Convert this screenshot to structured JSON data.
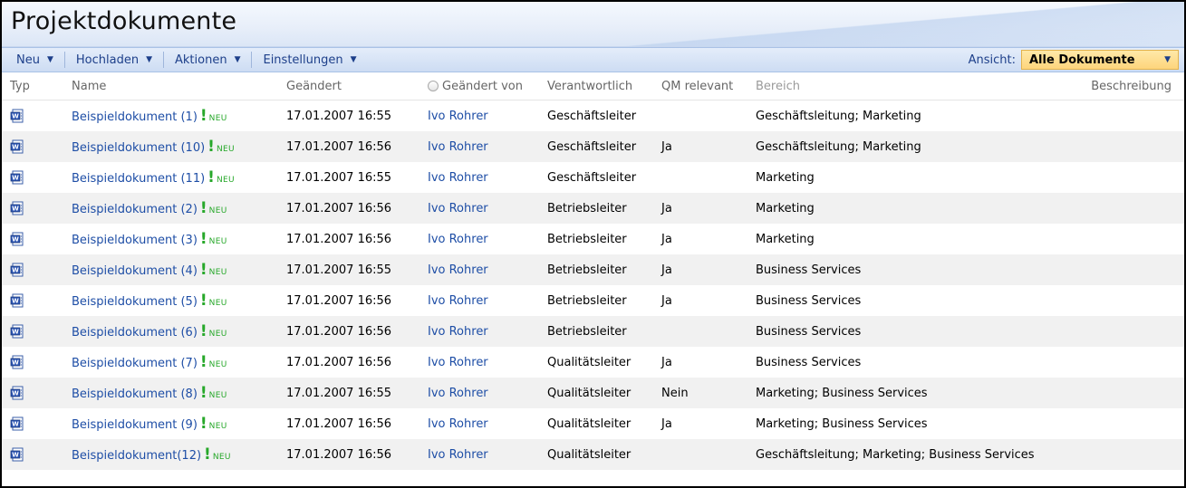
{
  "title": "Projektdokumente",
  "toolbar": {
    "new_label": "Neu",
    "upload_label": "Hochladen",
    "actions_label": "Aktionen",
    "settings_label": "Einstellungen",
    "view_label": "Ansicht:",
    "view_value": "Alle Dokumente"
  },
  "columns": {
    "typ": "Typ",
    "name": "Name",
    "modified": "Geändert",
    "modified_by": "Geändert von",
    "responsible": "Verantwortlich",
    "qm": "QM relevant",
    "area": "Bereich",
    "description": "Beschreibung"
  },
  "new_badge": "NEU",
  "rows": [
    {
      "name": "Beispieldokument (1)",
      "modified": "17.01.2007 16:55",
      "by": "Ivo Rohrer",
      "resp": "Geschäftsleiter",
      "qm": "",
      "area": "Geschäftsleitung; Marketing"
    },
    {
      "name": "Beispieldokument (10)",
      "modified": "17.01.2007 16:56",
      "by": "Ivo Rohrer",
      "resp": "Geschäftsleiter",
      "qm": "Ja",
      "area": "Geschäftsleitung; Marketing"
    },
    {
      "name": "Beispieldokument (11)",
      "modified": "17.01.2007 16:55",
      "by": "Ivo Rohrer",
      "resp": "Geschäftsleiter",
      "qm": "",
      "area": "Marketing"
    },
    {
      "name": "Beispieldokument (2)",
      "modified": "17.01.2007 16:56",
      "by": "Ivo Rohrer",
      "resp": "Betriebsleiter",
      "qm": "Ja",
      "area": "Marketing"
    },
    {
      "name": "Beispieldokument (3)",
      "modified": "17.01.2007 16:56",
      "by": "Ivo Rohrer",
      "resp": "Betriebsleiter",
      "qm": "Ja",
      "area": "Marketing"
    },
    {
      "name": "Beispieldokument (4)",
      "modified": "17.01.2007 16:55",
      "by": "Ivo Rohrer",
      "resp": "Betriebsleiter",
      "qm": "Ja",
      "area": "Business Services"
    },
    {
      "name": "Beispieldokument (5)",
      "modified": "17.01.2007 16:56",
      "by": "Ivo Rohrer",
      "resp": "Betriebsleiter",
      "qm": "Ja",
      "area": "Business Services"
    },
    {
      "name": "Beispieldokument (6)",
      "modified": "17.01.2007 16:56",
      "by": "Ivo Rohrer",
      "resp": "Betriebsleiter",
      "qm": "",
      "area": "Business Services"
    },
    {
      "name": "Beispieldokument (7)",
      "modified": "17.01.2007 16:56",
      "by": "Ivo Rohrer",
      "resp": "Qualitätsleiter",
      "qm": "Ja",
      "area": "Business Services"
    },
    {
      "name": "Beispieldokument (8)",
      "modified": "17.01.2007 16:55",
      "by": "Ivo Rohrer",
      "resp": "Qualitätsleiter",
      "qm": "Nein",
      "area": "Marketing; Business Services"
    },
    {
      "name": "Beispieldokument (9)",
      "modified": "17.01.2007 16:56",
      "by": "Ivo Rohrer",
      "resp": "Qualitätsleiter",
      "qm": "Ja",
      "area": "Marketing; Business Services"
    },
    {
      "name": "Beispieldokument(12)",
      "modified": "17.01.2007 16:56",
      "by": "Ivo Rohrer",
      "resp": "Qualitätsleiter",
      "qm": "",
      "area": "Geschäftsleitung; Marketing; Business Services"
    }
  ]
}
